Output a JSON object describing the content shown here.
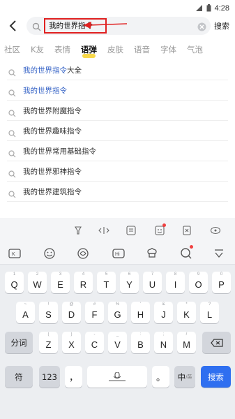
{
  "status_bar": {
    "time": "4:28"
  },
  "search": {
    "query": "我的世界指令",
    "submit_label": "搜索"
  },
  "category_tabs": [
    {
      "label": "社区"
    },
    {
      "label": "K友"
    },
    {
      "label": "表情"
    },
    {
      "label": "语弹",
      "active": true
    },
    {
      "label": "皮肤"
    },
    {
      "label": "语音"
    },
    {
      "label": "字体"
    },
    {
      "label": "气泡"
    }
  ],
  "suggestions": [
    {
      "highlight": "我的世界指令",
      "rest": "大全"
    },
    {
      "highlight": "我的世界指令",
      "rest": ""
    },
    {
      "highlight": "",
      "rest": "我的世界附魔指令"
    },
    {
      "highlight": "",
      "rest": "我的世界趣味指令"
    },
    {
      "highlight": "",
      "rest": "我的世界常用基础指令"
    },
    {
      "highlight": "",
      "rest": "我的世界邪神指令"
    },
    {
      "highlight": "",
      "rest": "我的世界建筑指令"
    }
  ],
  "keyboard": {
    "row1": [
      {
        "key": "Q",
        "sub": "1"
      },
      {
        "key": "W",
        "sub": "2"
      },
      {
        "key": "E",
        "sub": "3"
      },
      {
        "key": "R",
        "sub": "4"
      },
      {
        "key": "T",
        "sub": "5"
      },
      {
        "key": "Y",
        "sub": "6"
      },
      {
        "key": "U",
        "sub": "7"
      },
      {
        "key": "I",
        "sub": "8"
      },
      {
        "key": "O",
        "sub": "9"
      },
      {
        "key": "P",
        "sub": "0"
      }
    ],
    "row2": [
      {
        "key": "A",
        "sub": "~"
      },
      {
        "key": "S",
        "sub": "!"
      },
      {
        "key": "D",
        "sub": "@"
      },
      {
        "key": "F",
        "sub": "#"
      },
      {
        "key": "G",
        "sub": "%"
      },
      {
        "key": "H",
        "sub": "'"
      },
      {
        "key": "J",
        "sub": "&"
      },
      {
        "key": "K",
        "sub": "*"
      },
      {
        "key": "L",
        "sub": "?"
      }
    ],
    "row3": [
      {
        "key": "Z",
        "sub": "("
      },
      {
        "key": "X",
        "sub": ")"
      },
      {
        "key": "C",
        "sub": "-"
      },
      {
        "key": "V",
        "sub": "_"
      },
      {
        "key": "B",
        "sub": ":"
      },
      {
        "key": "N",
        "sub": ";"
      },
      {
        "key": "M",
        "sub": "/"
      }
    ],
    "segment_label": "分词",
    "symbol_label": "符",
    "number_label": "123",
    "comma_label": "，",
    "period_label": "。",
    "lang_label": "中",
    "lang_sub": "/英",
    "enter_label": "搜索"
  },
  "colors": {
    "highlight": "#2f5ec4",
    "annotation": "#e02020",
    "enter": "#2f6ff0"
  }
}
